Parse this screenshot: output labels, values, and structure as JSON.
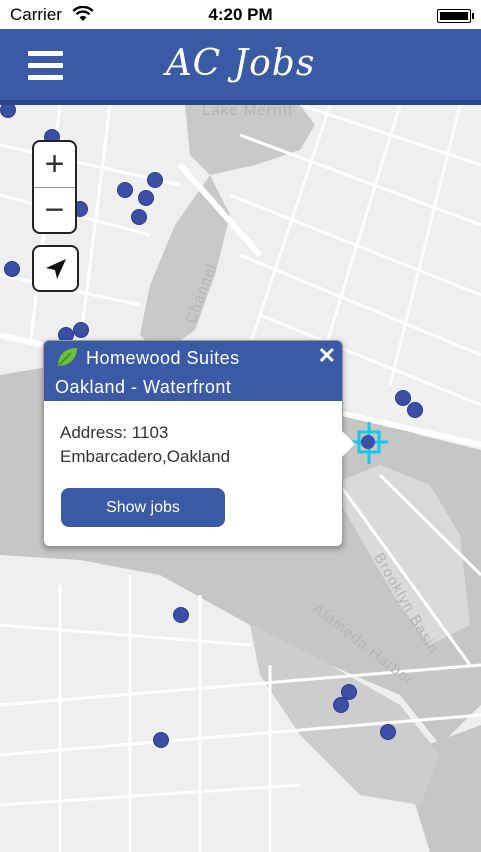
{
  "status_bar": {
    "carrier": "Carrier",
    "time": "4:20 PM"
  },
  "header": {
    "title": "AC Jobs",
    "menu_icon": "hamburger-menu-icon"
  },
  "map": {
    "labels": [
      "Lake Merritt",
      "Channel",
      "Brooklyn Basin",
      "Alameda Harbor"
    ],
    "zoom_in": "+",
    "zoom_out": "−",
    "locate_icon": "navigation-arrow-icon"
  },
  "popup": {
    "title_line1": "Homewood Suites",
    "title_line2": "Oakland - Waterfront",
    "close_label": "✕",
    "address_line1": "Address: 1103",
    "address_line2": "Embarcadero,Oakland",
    "button_label": "Show jobs"
  },
  "colors": {
    "brand": "#3b5aa6",
    "pin": "#3a4fa5",
    "selected_marker": "#19c8e6"
  }
}
